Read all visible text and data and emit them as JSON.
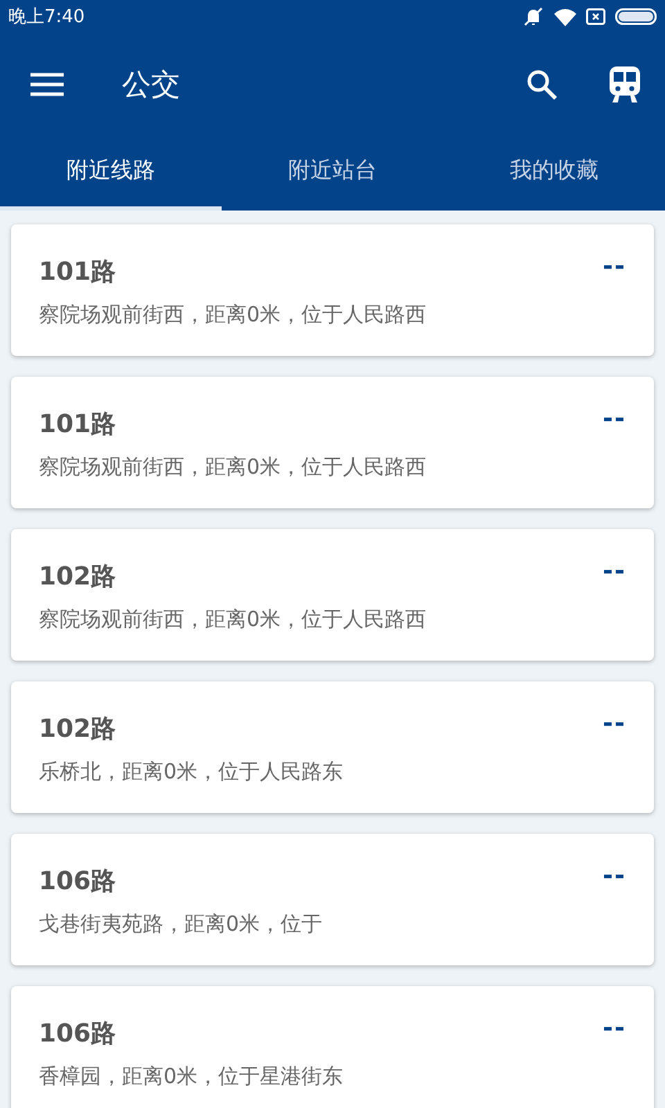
{
  "status_bar": {
    "time": "晚上7:40"
  },
  "toolbar": {
    "title": "公交"
  },
  "tabs": [
    {
      "label": "附近线路",
      "selected": true
    },
    {
      "label": "附近站台",
      "selected": false
    },
    {
      "label": "我的收藏",
      "selected": false
    }
  ],
  "routes": [
    {
      "name": "101路",
      "info": "察院场观前街西，距离0米，位于人民路西",
      "arrival": "--"
    },
    {
      "name": "101路",
      "info": "察院场观前街西，距离0米，位于人民路西",
      "arrival": "--"
    },
    {
      "name": "102路",
      "info": "察院场观前街西，距离0米，位于人民路西",
      "arrival": "--"
    },
    {
      "name": "102路",
      "info": "乐桥北，距离0米，位于人民路东",
      "arrival": "--"
    },
    {
      "name": "106路",
      "info": "戈巷街夷苑路，距离0米，位于",
      "arrival": "--"
    },
    {
      "name": "106路",
      "info": "香樟园，距离0米，位于星港街东",
      "arrival": "--"
    }
  ]
}
